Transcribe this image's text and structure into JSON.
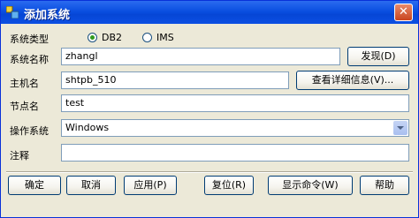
{
  "window": {
    "title": "添加系统"
  },
  "form": {
    "system_type": {
      "label": "系统类型",
      "options": [
        {
          "label": "DB2",
          "selected": true
        },
        {
          "label": "IMS",
          "selected": false
        }
      ]
    },
    "system_name": {
      "label": "系统名称",
      "value": "zhangl",
      "button": "发现(D)"
    },
    "host_name": {
      "label": "主机名",
      "value": "shtpb_510",
      "button": "查看详细信息(V)..."
    },
    "node_name": {
      "label": "节点名",
      "value": "test"
    },
    "os": {
      "label": "操作系统",
      "value": "Windows"
    },
    "comment": {
      "label": "注释",
      "value": ""
    }
  },
  "buttons": {
    "ok": "确定",
    "cancel": "取消",
    "apply": "应用(P)",
    "reset": "复位(R)",
    "show_command": "显示命令(W)",
    "help": "帮助"
  }
}
